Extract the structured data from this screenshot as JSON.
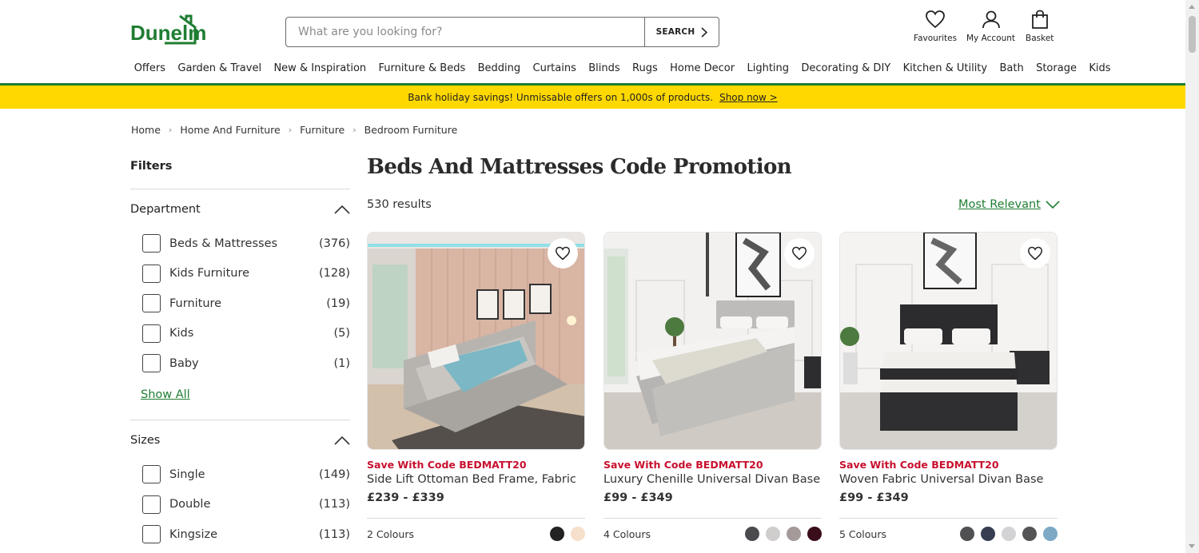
{
  "brand": {
    "logo_text": "Dunelm",
    "accent": "#1f7d32",
    "promo_red": "#c8102e",
    "banner_yellow": "#ffd800"
  },
  "search": {
    "placeholder": "What are you looking for?",
    "button_label": "SEARCH"
  },
  "header_icons": {
    "favourites": "Favourites",
    "account": "My Account",
    "basket": "Basket"
  },
  "nav": [
    "Offers",
    "Garden & Travel",
    "New & Inspiration",
    "Furniture & Beds",
    "Bedding",
    "Curtains",
    "Blinds",
    "Rugs",
    "Home Decor",
    "Lighting",
    "Decorating & DIY",
    "Kitchen & Utility",
    "Bath",
    "Storage",
    "Kids"
  ],
  "promo_banner": {
    "text": "Bank holiday savings! Unmissable offers on 1,000s of products.",
    "link": "Shop now >"
  },
  "breadcrumb": [
    "Home",
    "Home And Furniture",
    "Furniture",
    "Bedroom Furniture"
  ],
  "filters": {
    "title": "Filters",
    "department": {
      "title": "Department",
      "options": [
        {
          "label": "Beds & Mattresses",
          "count": "(376)"
        },
        {
          "label": "Kids Furniture",
          "count": "(128)"
        },
        {
          "label": "Furniture",
          "count": "(19)"
        },
        {
          "label": "Kids",
          "count": "(5)"
        },
        {
          "label": "Baby",
          "count": "(1)"
        }
      ],
      "show_all": "Show All"
    },
    "sizes": {
      "title": "Sizes",
      "options": [
        {
          "label": "Single",
          "count": "(149)"
        },
        {
          "label": "Double",
          "count": "(113)"
        },
        {
          "label": "Kingsize",
          "count": "(113)"
        }
      ]
    }
  },
  "main": {
    "title": "Beds And Mattresses Code Promotion",
    "results": "530 results",
    "sort_label": "Most Relevant"
  },
  "products": [
    {
      "promo": "Save With Code BEDMATT20",
      "name": "Side Lift Ottoman Bed Frame, Fabric",
      "price": "£239 - £339",
      "colours": "2 Colours",
      "swatches": [
        "#222222",
        "#f6e0cb"
      ]
    },
    {
      "promo": "Save With Code BEDMATT20",
      "name": "Luxury Chenille Universal Divan Base",
      "price": "£99 - £349",
      "colours": "4 Colours",
      "swatches": [
        "#4a4a4f",
        "#d0cdcd",
        "#a49a99",
        "#3a0d1a"
      ]
    },
    {
      "promo": "Save With Code BEDMATT20",
      "name": "Woven Fabric Universal Divan Base",
      "price": "£99 - £349",
      "colours": "5 Colours",
      "swatches": [
        "#505052",
        "#383e52",
        "#d3d3d6",
        "#545457",
        "#7da9c7"
      ]
    }
  ]
}
